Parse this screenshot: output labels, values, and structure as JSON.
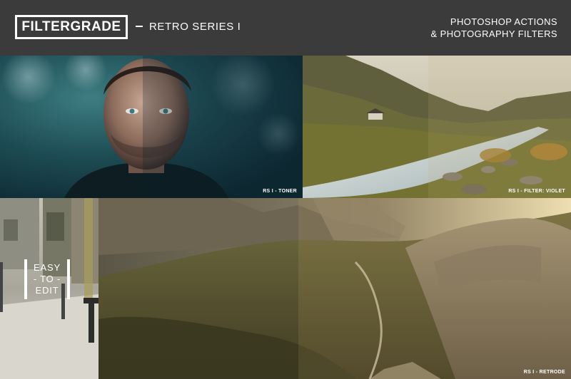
{
  "header": {
    "logo": "FILTERGRADE",
    "series": "RETRO SERIES I",
    "tagline_line1": "PHOTOSHOP ACTIONS",
    "tagline_line2": "& PHOTOGRAPHY FILTERS"
  },
  "panels": {
    "portrait_caption": "RS I - TONER",
    "river_caption": "RS I - FILTER: VIOLET",
    "mountain_caption": "RS I - RETRODE"
  },
  "badge": {
    "line1": "EASY",
    "line2": "- TO -",
    "line3": "EDIT"
  },
  "colors": {
    "header_bg": "#3b3b3b",
    "text": "#ffffff"
  }
}
